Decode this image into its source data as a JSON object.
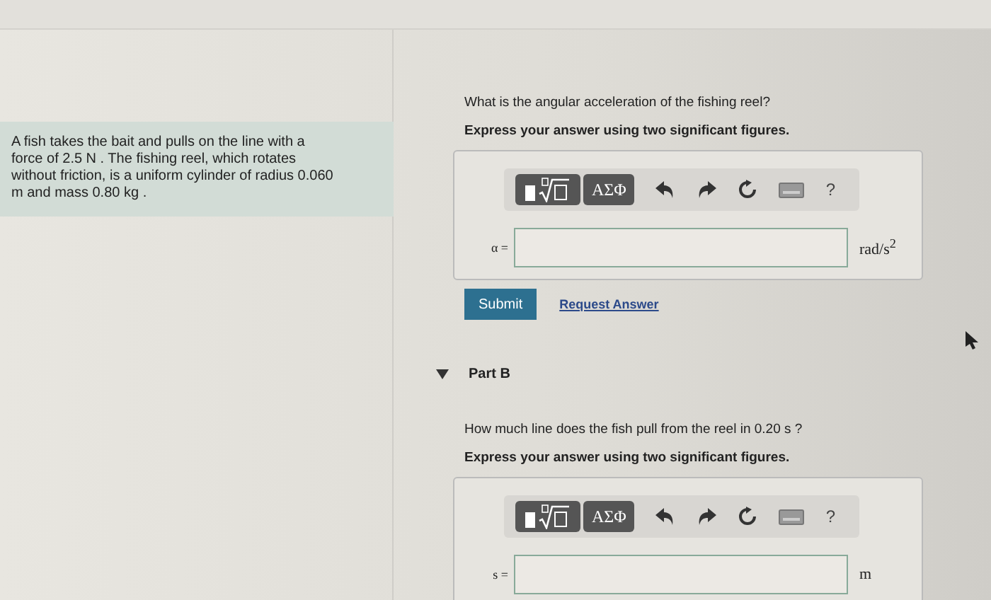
{
  "problem": {
    "text": "A fish takes the bait and pulls on the line with a force of 2.5 N . The fishing reel, which rotates without friction, is a uniform cylinder of radius 0.060 m and mass 0.80 kg ."
  },
  "parts": [
    {
      "question": "What is the angular acceleration of the fishing reel?",
      "instruction": "Express your answer using two significant figures.",
      "toolbar": {
        "symbols": "ΑΣΦ",
        "help": "?"
      },
      "variable": "α =",
      "unit": "rad/s$^{2}$",
      "submit": "Submit",
      "request": "Request Answer"
    },
    {
      "header": "Part B",
      "expanded": true,
      "question": "How much line does the fish pull from the reel in 0.20 s ?",
      "instruction": "Express your answer using two significant figures.",
      "toolbar": {
        "symbols": "ΑΣΦ",
        "help": "?"
      },
      "variable": "s =",
      "unit": "m"
    }
  ]
}
